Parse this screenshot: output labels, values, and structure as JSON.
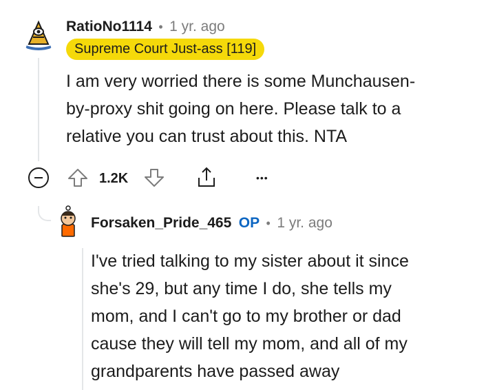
{
  "comment": {
    "username": "RatioNo1114",
    "separator": "•",
    "time": "1 yr. ago",
    "flair": "Supreme Court Just-ass [119]",
    "body": "I am very worried there is some Munchausen-\nby-proxy shit going on here. Please talk to a\nrelative you can trust about this. NTA",
    "votes": "1.2K",
    "more": "•••",
    "icons": [
      "collapse-icon",
      "upvote-icon",
      "downvote-icon",
      "share-icon",
      "more-icon"
    ]
  },
  "reply": {
    "username": "Forsaken_Pride_465",
    "op_badge": "OP",
    "separator": "•",
    "time": "1 yr. ago",
    "body": "I've tried talking to my sister about it since\nshe's 29, but any time I do, she tells my\nmom, and I can't go to my brother or dad\ncause they will tell my mom, and all of my\ngrandparents have passed away"
  },
  "colors": {
    "flair_bg": "#f5d90a",
    "op": "#0d66c2",
    "meta": "#7c7c7c"
  }
}
